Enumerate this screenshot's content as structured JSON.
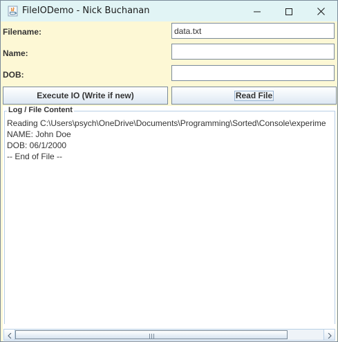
{
  "window": {
    "title": "FileIODemo - Nick Buchanan",
    "controls": {
      "minimize_icon": "minimize-icon",
      "maximize_icon": "maximize-icon",
      "close_icon": "close-icon"
    }
  },
  "form": {
    "filename_label": "Filename:",
    "filename_value": "data.txt",
    "name_label": "Name:",
    "name_value": "",
    "dob_label": "DOB:",
    "dob_value": ""
  },
  "buttons": {
    "execute_label": "Execute IO (Write if new)",
    "read_label": "Read File"
  },
  "log": {
    "title": "Log / File Content",
    "lines": [
      "Reading C:\\Users\\psych\\OneDrive\\Documents\\Programming\\Sorted\\Console\\experime",
      "NAME: John Doe",
      "DOB: 06/1/2000",
      "-- End of File --"
    ]
  },
  "scrollbar": {
    "thumb_fraction": 0.86
  },
  "colors": {
    "form_background": "#fdf8d5",
    "titlebar_background": "#e1f4f5",
    "border": "#7a8a99",
    "panel_border": "#b8cfe5"
  }
}
